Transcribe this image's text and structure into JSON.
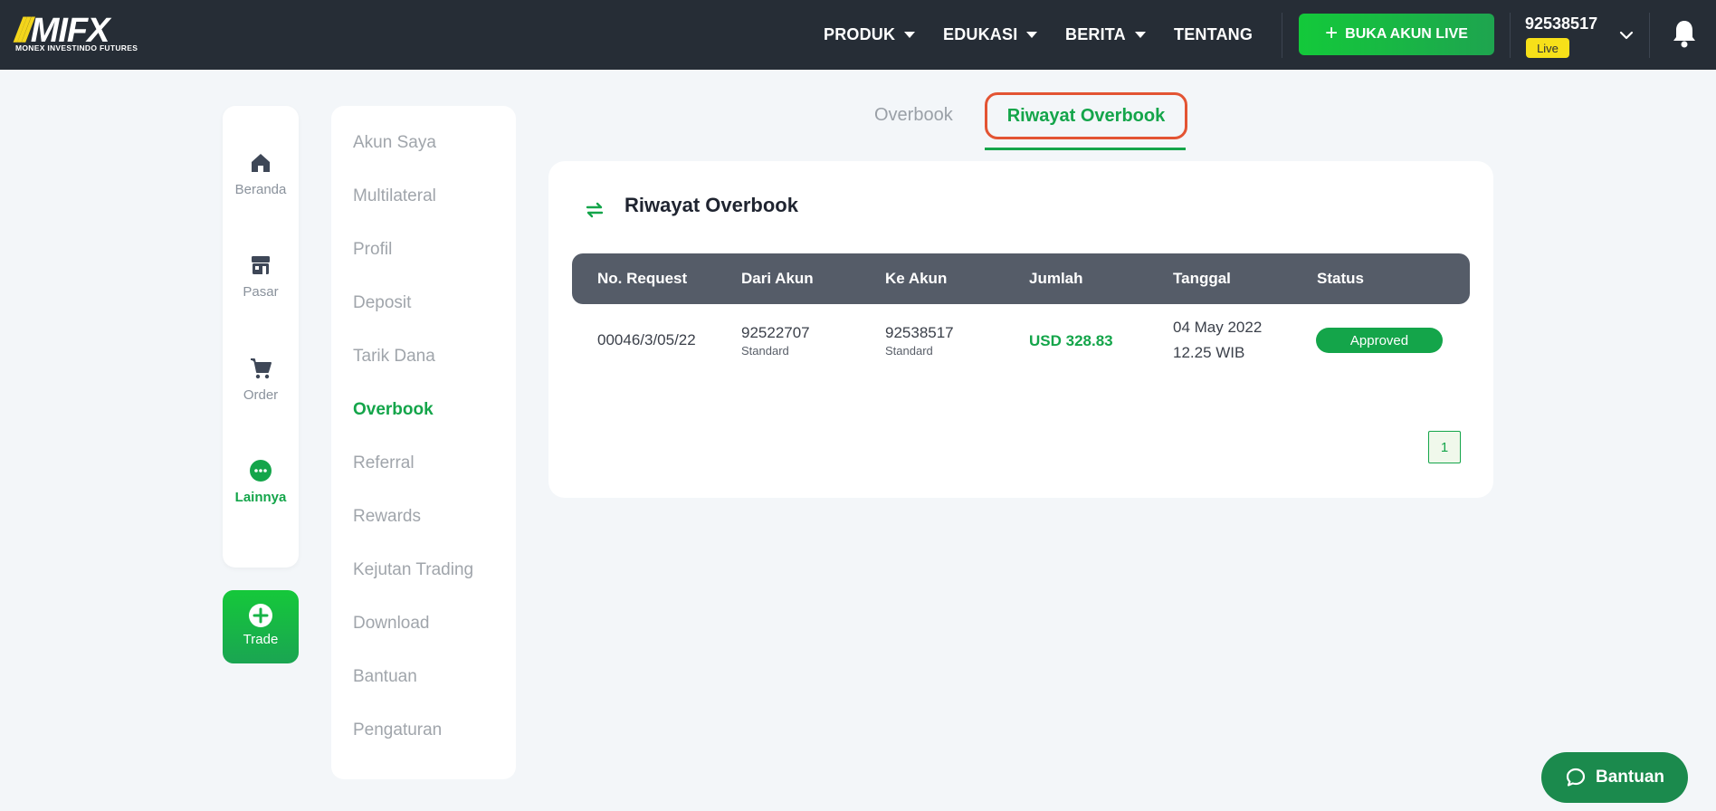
{
  "header": {
    "logo_text": "MIFX",
    "logo_subtitle": "MONEX INVESTINDO FUTURES",
    "nav": [
      "PRODUK",
      "EDUKASI",
      "BERITA",
      "TENTANG"
    ],
    "cta_label": "BUKA AKUN LIVE",
    "account_number": "92538517",
    "account_badge": "Live"
  },
  "rail": {
    "items": [
      {
        "label": "Beranda",
        "icon": "home-icon"
      },
      {
        "label": "Pasar",
        "icon": "store-icon"
      },
      {
        "label": "Order",
        "icon": "cart-icon"
      },
      {
        "label": "Lainnya",
        "icon": "more-icon",
        "active": true
      }
    ],
    "trade_label": "Trade"
  },
  "menu": {
    "items": [
      "Akun Saya",
      "Multilateral",
      "Profil",
      "Deposit",
      "Tarik Dana",
      "Overbook",
      "Referral",
      "Rewards",
      "Kejutan Trading",
      "Download",
      "Bantuan",
      "Pengaturan"
    ],
    "active": "Overbook"
  },
  "tabs": {
    "items": [
      "Overbook",
      "Riwayat Overbook"
    ],
    "active": "Riwayat Overbook"
  },
  "card": {
    "title": "Riwayat Overbook",
    "columns": [
      "No. Request",
      "Dari Akun",
      "Ke Akun",
      "Jumlah",
      "Tanggal",
      "Status"
    ],
    "rows": [
      {
        "request_no": "00046/3/05/22",
        "from_account": "92522707",
        "from_type": "Standard",
        "to_account": "92538517",
        "to_type": "Standard",
        "amount": "USD 328.83",
        "date": "04 May 2022",
        "time": "12.25 WIB",
        "status": "Approved"
      }
    ],
    "pagination": {
      "current_page": "1"
    }
  },
  "help_label": "Bantuan",
  "colors": {
    "brand_green": "#14a54a",
    "header_bg": "#262d36",
    "highlight_ring": "#e35433",
    "badge_yellow": "#f7e019"
  }
}
